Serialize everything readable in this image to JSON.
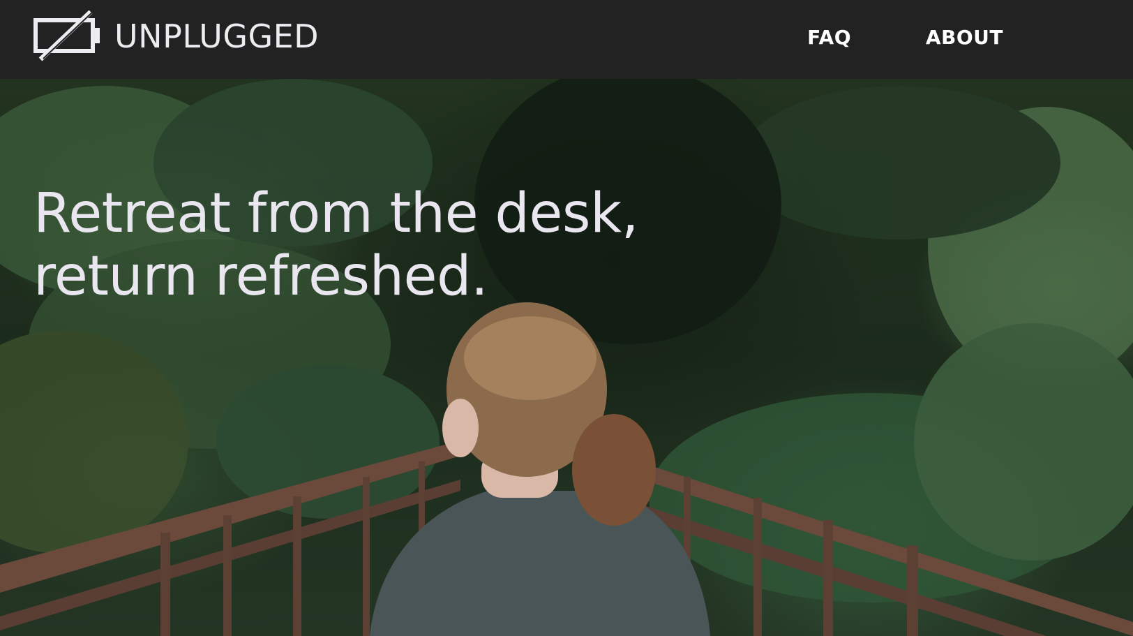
{
  "brand": {
    "name": "UNPLUGGED",
    "icon": "unplugged-battery-icon"
  },
  "nav": {
    "items": [
      {
        "label": "FAQ"
      },
      {
        "label": "ABOUT"
      }
    ]
  },
  "hero": {
    "headline_line1": "Retreat from the desk,",
    "headline_line2": "return refreshed.",
    "image": "woman-on-forest-bridge"
  },
  "colors": {
    "topbar": "#222222",
    "text": "#ececf1",
    "nav_text": "#ffffff"
  }
}
